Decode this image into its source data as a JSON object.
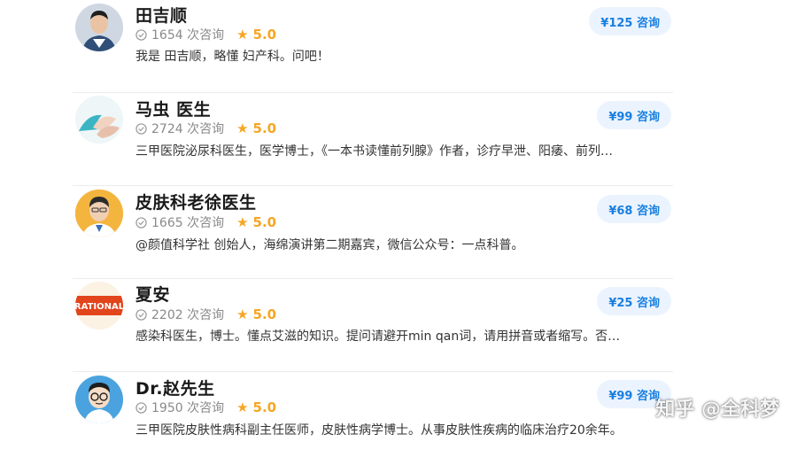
{
  "doctors": [
    {
      "name": "田吉顺",
      "consult_count": "1654 次咨询",
      "rating": "5.0",
      "description": "我是 田吉顺，略懂 妇产科。问吧！",
      "price": "¥125 咨询",
      "avatar_icon": "doctor-photo-icon"
    },
    {
      "name": "马虫 医生",
      "consult_count": "2724 次咨询",
      "rating": "5.0",
      "description": "三甲医院泌尿科医生，医学博士，《一本书读懂前列腺》作者，诊疗早泄、阳痿、前列…",
      "price": "¥99 咨询",
      "avatar_icon": "hands-photo-icon"
    },
    {
      "name": "皮肤科老徐医生",
      "consult_count": "1665 次咨询",
      "rating": "5.0",
      "description": "@颜值科学社 创始人，海绵演讲第二期嘉宾，微信公众号：一点科普。",
      "price": "¥68 咨询",
      "avatar_icon": "doctor-cartoon-icon"
    },
    {
      "name": "夏安",
      "consult_count": "2202 次咨询",
      "rating": "5.0",
      "description": "感染科医生，博士。懂点艾滋的知识。提问请避开min qan词，请用拼音或者缩写。否…",
      "price": "¥25 咨询",
      "avatar_icon": "rational-logo-icon",
      "avatar_text": "RATIONAL"
    },
    {
      "name": "Dr.赵先生",
      "consult_count": "1950 次咨询",
      "rating": "5.0",
      "description": "三甲医院皮肤性病科副主任医师，皮肤性病学博士。从事皮肤性疾病的临床治疗20余年。",
      "price": "¥99 咨询",
      "avatar_icon": "cartoon-doctor-icon"
    }
  ],
  "watermark": "知乎 @全科梦",
  "colors": {
    "accent": "#1a7fe0",
    "price_bg": "#ebf4fe",
    "star": "#f5a623"
  }
}
